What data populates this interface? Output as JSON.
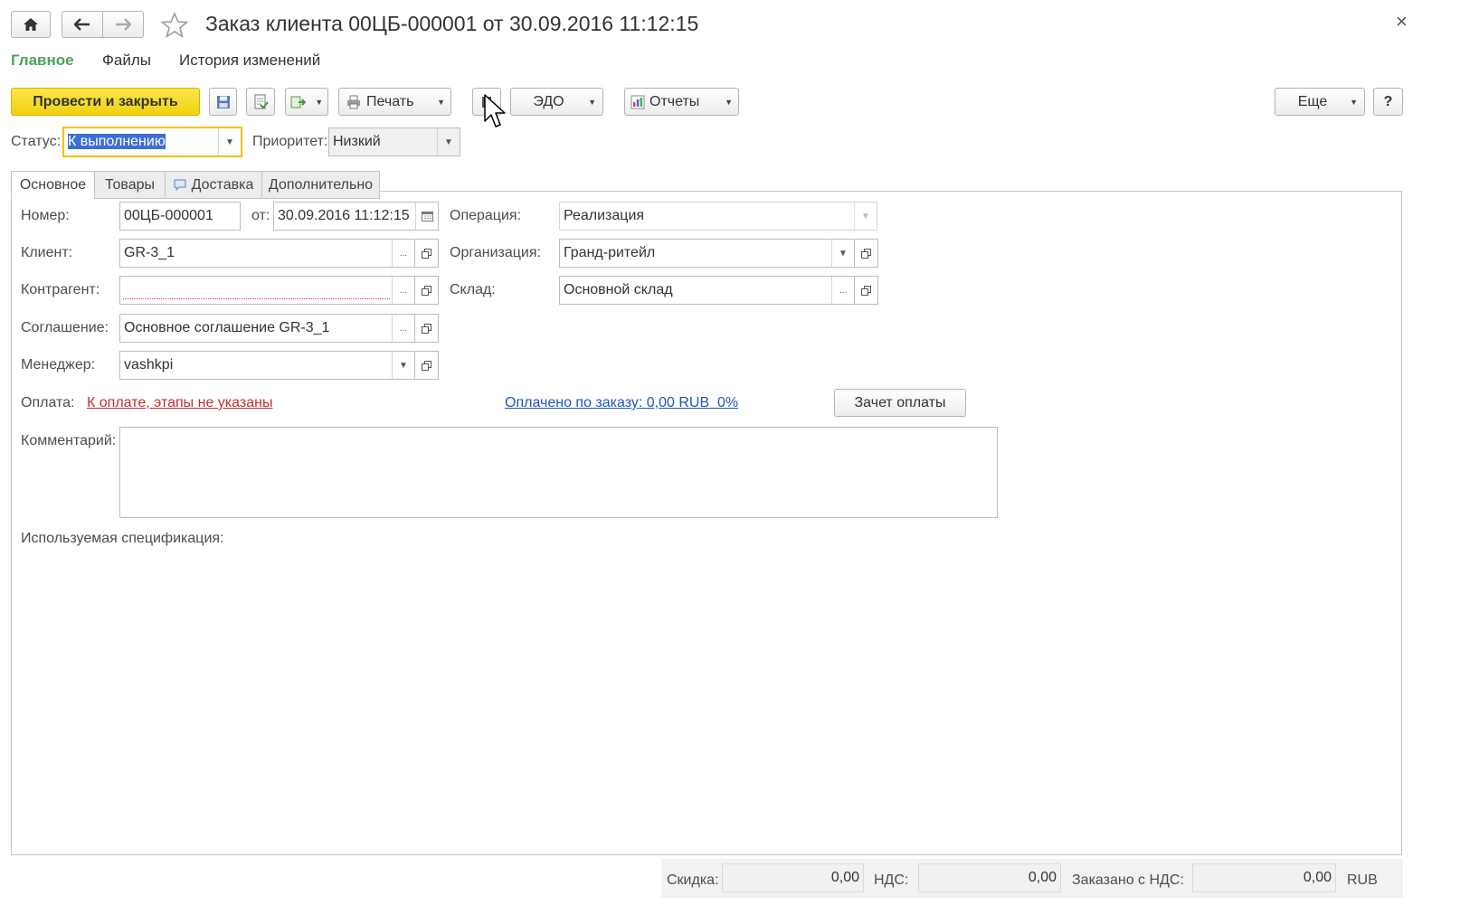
{
  "window": {
    "title": "Заказ клиента 00ЦБ-000001 от 30.09.2016 11:12:15",
    "close": "×"
  },
  "nav_tabs": [
    "Главное",
    "Файлы",
    "История изменений"
  ],
  "toolbar": {
    "post_close": "Провести и закрыть",
    "print": "Печать",
    "edo": "ЭДО",
    "reports": "Отчеты",
    "more": "Еще",
    "help": "?"
  },
  "status": {
    "label": "Статус:",
    "value": "К выполнению",
    "priority_label": "Приоритет:",
    "priority_value": "Низкий"
  },
  "tabs": [
    "Основное",
    "Товары",
    "Доставка",
    "Дополнительно"
  ],
  "form": {
    "number_label": "Номер:",
    "number_value": "00ЦБ-000001",
    "date_label": "от:",
    "date_value": "30.09.2016 11:12:15",
    "operation_label": "Операция:",
    "operation_value": "Реализация",
    "client_label": "Клиент:",
    "client_value": "GR-3_1",
    "organization_label": "Организация:",
    "organization_value": "Гранд-ритейл",
    "counterparty_label": "Контрагент:",
    "counterparty_value": "",
    "warehouse_label": "Склад:",
    "warehouse_value": "Основной склад",
    "agreement_label": "Соглашение:",
    "agreement_value": "Основное соглашение GR-3_1",
    "manager_label": "Менеджер:",
    "manager_value": "vashkpi",
    "payment_label": "Оплата:",
    "payment_link": "К оплате, этапы не указаны",
    "paid_link": "Оплачено по заказу: 0,00 RUB  0%",
    "offset_button": "Зачет оплаты",
    "comment_label": "Комментарий:",
    "comment_value": "",
    "spec_label": "Используемая спецификация:"
  },
  "totals": {
    "discount_label": "Скидка:",
    "discount_value": "0,00",
    "vat_label": "НДС:",
    "vat_value": "0,00",
    "ordered_label": "Заказано с НДС:",
    "ordered_value": "0,00",
    "currency": "RUB"
  },
  "colors": {
    "accent_green": "#4aa35a",
    "primary_yellow": "#f6dc1a",
    "link_blue": "#1f57b8",
    "link_red": "#c03030",
    "focus_yellow": "#f2c200"
  }
}
